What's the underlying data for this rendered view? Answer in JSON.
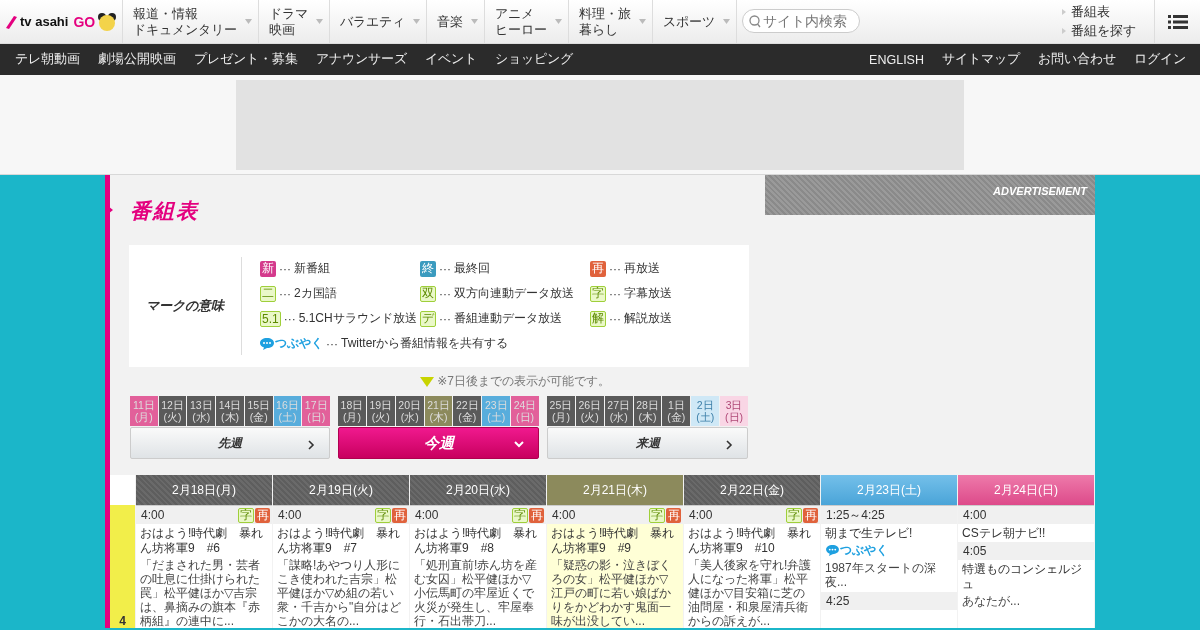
{
  "header": {
    "logo": {
      "text": "tv asahi",
      "go": "GO"
    },
    "nav": [
      {
        "lines": [
          "報道・情報",
          "ドキュメンタリー"
        ]
      },
      {
        "lines": [
          "ドラマ",
          "映画"
        ]
      },
      {
        "lines": [
          "バラエティ"
        ]
      },
      {
        "lines": [
          "音楽"
        ]
      },
      {
        "lines": [
          "アニメ",
          "ヒーロー"
        ]
      },
      {
        "lines": [
          "料理・旅",
          "暮らし"
        ]
      },
      {
        "lines": [
          "スポーツ"
        ]
      }
    ],
    "search": {
      "placeholder": "サイト内検索"
    },
    "quick_links": [
      "番組表",
      "番組を探す"
    ]
  },
  "subnav": {
    "left": [
      "テレ朝動画",
      "劇場公開映画",
      "プレゼント・募集",
      "アナウンサーズ",
      "イベント",
      "ショッピング"
    ],
    "right": [
      "ENGLISH",
      "サイトマップ",
      "お問い合わせ",
      "ログイン"
    ]
  },
  "page_title": "番組表",
  "advertisement": "ADVERTISEMENT",
  "legend": {
    "title": "マークの意味",
    "items": [
      {
        "mark": "新",
        "kind": "new",
        "dots": "···",
        "text": "新番組"
      },
      {
        "mark": "終",
        "kind": "final",
        "dots": "···",
        "text": "最終回"
      },
      {
        "mark": "再",
        "kind": "rerun",
        "dots": "···",
        "text": "再放送"
      },
      {
        "mark": "二",
        "kind": "info",
        "dots": "···",
        "text": "2カ国語"
      },
      {
        "mark": "双",
        "kind": "info",
        "dots": "···",
        "text": "双方向連動データ放送"
      },
      {
        "mark": "字",
        "kind": "info",
        "dots": "···",
        "text": "字幕放送"
      },
      {
        "mark": "5.1",
        "kind": "info",
        "dots": "···",
        "text": "5.1CHサラウンド放送"
      },
      {
        "mark": "デ",
        "kind": "info",
        "dots": "···",
        "text": "番組連動データ放送"
      },
      {
        "mark": "解",
        "kind": "info",
        "dots": "···",
        "text": "解説放送"
      },
      {
        "mark": "つぶやく",
        "kind": "tweet",
        "dots": "···",
        "text": "Twitterから番組情報を共有する"
      }
    ]
  },
  "note": "※7日後までの表示が可能です。",
  "weeks": [
    {
      "button": "先週",
      "selected": false,
      "days": [
        {
          "day": "11日",
          "weekday": "(月)",
          "kind": "holiday",
          "disabled": false
        },
        {
          "day": "12日",
          "weekday": "(火)",
          "kind": "weekday",
          "disabled": false
        },
        {
          "day": "13日",
          "weekday": "(水)",
          "kind": "weekday",
          "disabled": false
        },
        {
          "day": "14日",
          "weekday": "(木)",
          "kind": "weekday",
          "disabled": false
        },
        {
          "day": "15日",
          "weekday": "(金)",
          "kind": "weekday",
          "disabled": false
        },
        {
          "day": "16日",
          "weekday": "(土)",
          "kind": "saturday",
          "disabled": false
        },
        {
          "day": "17日",
          "weekday": "(日)",
          "kind": "sunday",
          "disabled": false
        }
      ]
    },
    {
      "button": "今週",
      "selected": true,
      "days": [
        {
          "day": "18日",
          "weekday": "(月)",
          "kind": "weekday",
          "disabled": false
        },
        {
          "day": "19日",
          "weekday": "(火)",
          "kind": "weekday",
          "disabled": false
        },
        {
          "day": "20日",
          "weekday": "(水)",
          "kind": "weekday",
          "disabled": false
        },
        {
          "day": "21日",
          "weekday": "(木)",
          "kind": "today",
          "disabled": false
        },
        {
          "day": "22日",
          "weekday": "(金)",
          "kind": "weekday",
          "disabled": false
        },
        {
          "day": "23日",
          "weekday": "(土)",
          "kind": "saturday",
          "disabled": false
        },
        {
          "day": "24日",
          "weekday": "(日)",
          "kind": "sunday",
          "disabled": false
        }
      ]
    },
    {
      "button": "来週",
      "selected": false,
      "days": [
        {
          "day": "25日",
          "weekday": "(月)",
          "kind": "weekday",
          "disabled": false
        },
        {
          "day": "26日",
          "weekday": "(火)",
          "kind": "weekday",
          "disabled": false
        },
        {
          "day": "27日",
          "weekday": "(水)",
          "kind": "weekday",
          "disabled": false
        },
        {
          "day": "28日",
          "weekday": "(木)",
          "kind": "weekday",
          "disabled": false
        },
        {
          "day": "1日",
          "weekday": "(金)",
          "kind": "weekday",
          "disabled": false
        },
        {
          "day": "2日",
          "weekday": "(土)",
          "kind": "saturday",
          "disabled": true
        },
        {
          "day": "3日",
          "weekday": "(日)",
          "kind": "sunday",
          "disabled": true
        }
      ]
    }
  ],
  "schedule": {
    "hours": [
      "4"
    ],
    "days": [
      {
        "date": "2月18日(月)",
        "kind": "weekday",
        "programs": [
          {
            "time": "4:00",
            "marks": [
              {
                "mark": "字",
                "kind": "info"
              },
              {
                "mark": "再",
                "kind": "rerun"
              }
            ],
            "title": "おはよう!時代劇　暴れん坊将軍9　#6",
            "description": "「だまされた男・芸者の吐息に仕掛けられた罠」松平健ほか▽吉宗は、鼻摘みの旗本『赤柄組』の連中に..."
          }
        ]
      },
      {
        "date": "2月19日(火)",
        "kind": "weekday",
        "programs": [
          {
            "time": "4:00",
            "marks": [
              {
                "mark": "字",
                "kind": "info"
              },
              {
                "mark": "再",
                "kind": "rerun"
              }
            ],
            "title": "おはよう!時代劇　暴れん坊将軍9　#7",
            "description": "「謀略!あやつり人形にこき使われた吉宗」松平健ほか▽め組の若い衆・千吉から\"自分はどこかの大名の..."
          }
        ]
      },
      {
        "date": "2月20日(水)",
        "kind": "weekday",
        "programs": [
          {
            "time": "4:00",
            "marks": [
              {
                "mark": "字",
                "kind": "info"
              },
              {
                "mark": "再",
                "kind": "rerun"
              }
            ],
            "title": "おはよう!時代劇　暴れん坊将軍9　#8",
            "description": "「処刑直前!赤ん坊を産む女囚」松平健ほか▽小伝馬町の牢屋近くで火災が発生し、牢屋奉行・石出帯刀..."
          }
        ]
      },
      {
        "date": "2月21日(木)",
        "kind": "today",
        "programs": [
          {
            "time": "4:00",
            "marks": [
              {
                "mark": "字",
                "kind": "info"
              },
              {
                "mark": "再",
                "kind": "rerun"
              }
            ],
            "title": "おはよう!時代劇　暴れん坊将軍9　#9",
            "description": "「疑惑の影・泣きぼくろの女」松平健ほか▽江戸の町に若い娘ばかりをかどわかす鬼面一味が出没してい..."
          }
        ]
      },
      {
        "date": "2月22日(金)",
        "kind": "weekday",
        "programs": [
          {
            "time": "4:00",
            "marks": [
              {
                "mark": "字",
                "kind": "info"
              },
              {
                "mark": "再",
                "kind": "rerun"
              }
            ],
            "title": "おはよう!時代劇　暴れん坊将軍9　#10",
            "description": "「美人後家を守れ!弁護人になった将軍」松平健ほか▽目安箱に芝の油問屋・和泉屋清兵衛からの訴えが..."
          }
        ]
      },
      {
        "date": "2月23日(土)",
        "kind": "saturday",
        "programs": [
          {
            "time": "1:25～4:25",
            "title": "朝まで生テレビ!",
            "tweet": "つぶやく",
            "description": "1987年スタートの深夜..."
          },
          {
            "time": "4:25"
          }
        ]
      },
      {
        "date": "2月24日(日)",
        "kind": "sunday",
        "programs": [
          {
            "time": "4:00",
            "title": "CSテレ朝ナビ!!"
          },
          {
            "time": "4:05",
            "title": "特選ものコンシェルジュ",
            "description": "あなたが..."
          }
        ]
      }
    ]
  }
}
